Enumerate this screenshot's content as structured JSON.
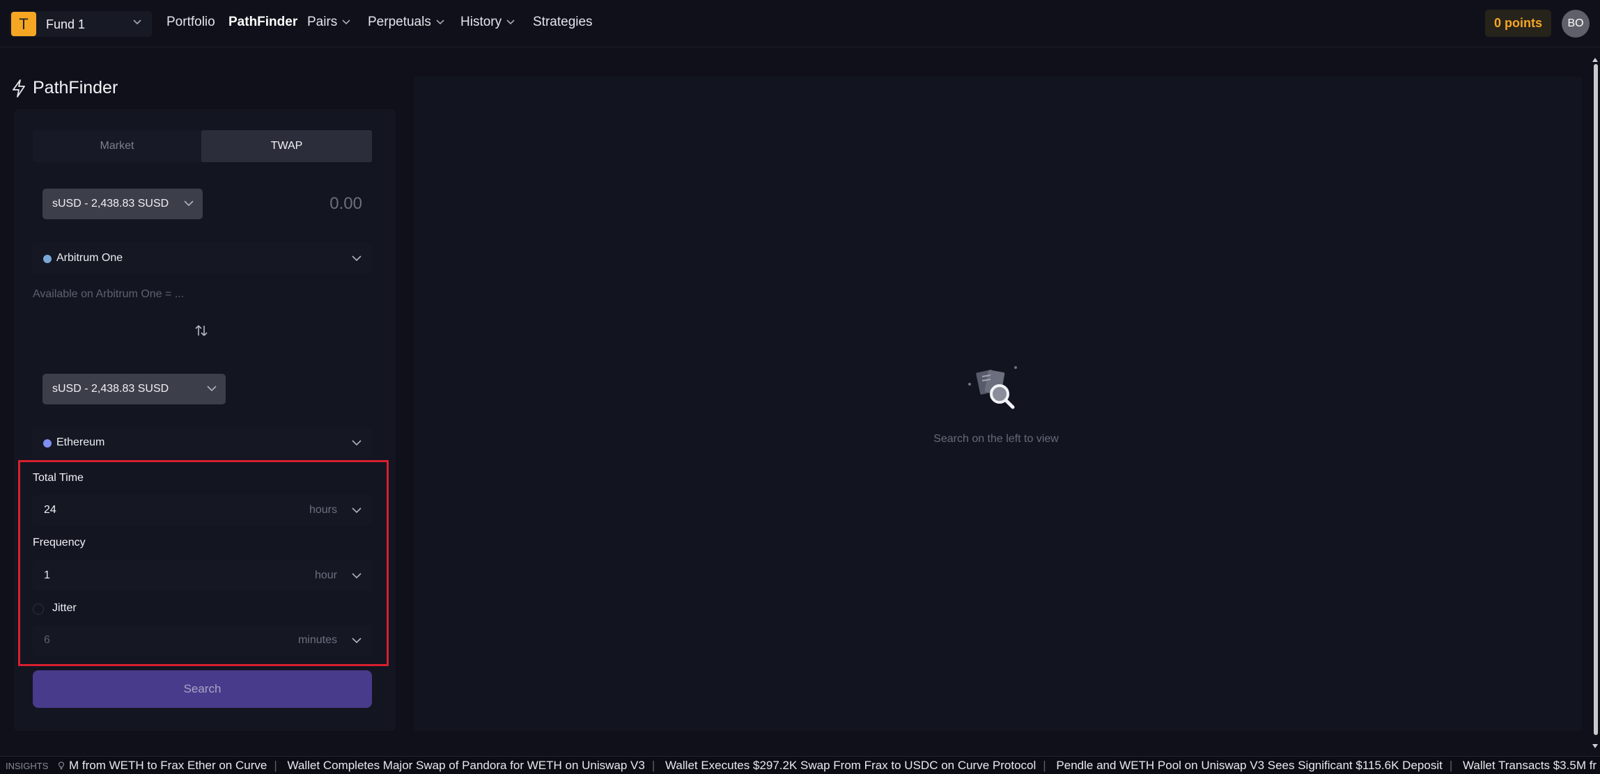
{
  "app": {
    "fund_label": "Fund 1",
    "fund_logo_letter": "T",
    "nav": [
      {
        "label": "Portfolio"
      },
      {
        "label": "PathFinder"
      },
      {
        "label": "Pairs"
      },
      {
        "label": "Perpetuals"
      },
      {
        "label": "History"
      },
      {
        "label": "Strategies"
      }
    ],
    "points_label": "0 points",
    "avatar_initials": "BO",
    "accent_color": "#f5a623"
  },
  "page": {
    "title": "PathFinder"
  },
  "form": {
    "tabs": [
      {
        "label": "Market"
      },
      {
        "label": "TWAP"
      }
    ],
    "from_token": "sUSD - 2,438.83 SUSD",
    "amount": "0.00",
    "from_chain": "Arbitrum One",
    "available_text": "Available on Arbitrum One = ...",
    "to_token": "sUSD - 2,438.83 SUSD",
    "to_chain": "Ethereum",
    "total_time_label": "Total Time",
    "total_time_value": "24",
    "total_time_unit": "hours",
    "frequency_label": "Frequency",
    "frequency_value": "1",
    "frequency_unit": "hour",
    "jitter_label": "Jitter",
    "jitter_value": "6",
    "jitter_unit": "minutes",
    "search_label": "Search"
  },
  "results": {
    "empty_text": "Search on the left to view"
  },
  "ticker": {
    "label": "INSIGHTS",
    "items": [
      "M from WETH to Frax Ether on Curve",
      "Wallet Completes Major Swap of Pandora for WETH on Uniswap V3",
      "Wallet Executes $297.2K Swap From Frax to USDC on Curve Protocol",
      "Pendle and WETH Pool on Uniswap V3 Sees Significant $115.6K Deposit",
      "Wallet Transacts $3.5M fr"
    ]
  }
}
